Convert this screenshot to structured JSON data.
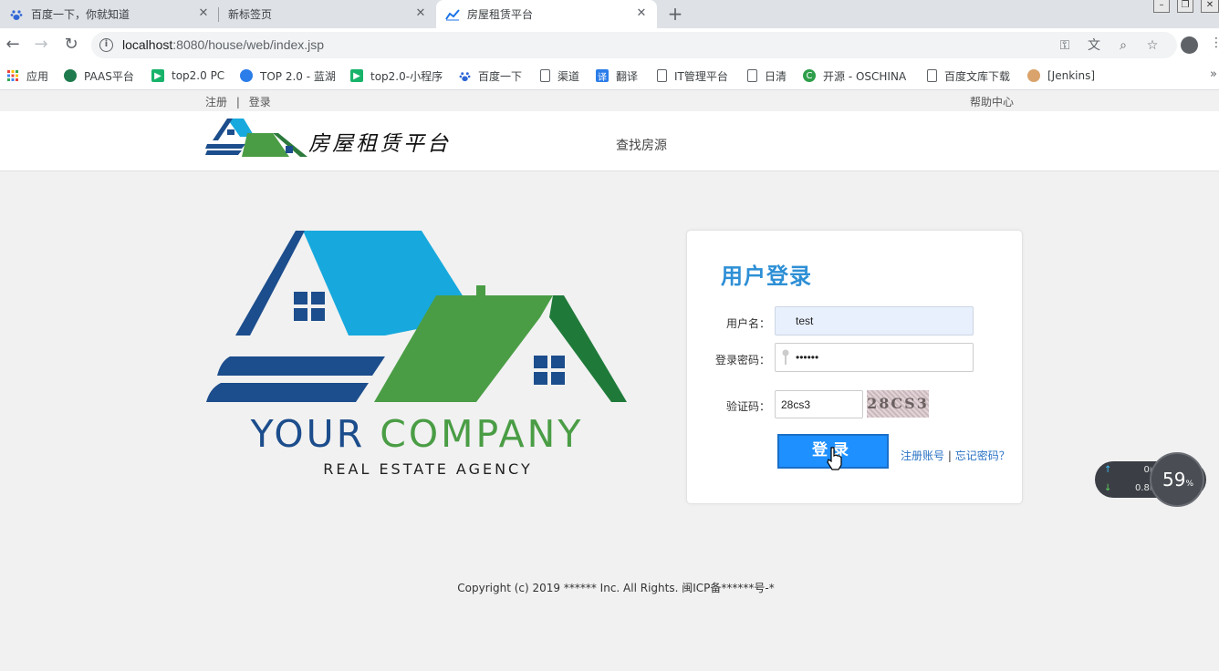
{
  "browser": {
    "tabs": [
      {
        "title": "百度一下，你就知道",
        "icon": "baidu-paw-icon"
      },
      {
        "title": "新标签页",
        "icon": ""
      },
      {
        "title": "房屋租赁平台",
        "icon": "chart-icon"
      }
    ],
    "url_host": "localhost",
    "url_path": ":8080/house/web/index.jsp",
    "bookmarks": [
      "应用",
      "PAAS平台",
      "top2.0 PC",
      "TOP 2.0 - 蓝湖",
      "top2.0-小程序",
      "百度一下",
      "渠道",
      "翻译",
      "IT管理平台",
      "日清",
      "开源 - OSCHINA",
      "百度文库下载",
      "[Jenkins]"
    ],
    "bookmarks_more": "»"
  },
  "topbar": {
    "register": "注册",
    "separator": "|",
    "login": "登录",
    "help": "帮助中心"
  },
  "header": {
    "brand": "房屋租赁平台",
    "nav_find": "查找房源"
  },
  "hero": {
    "your": "YOUR",
    "company": "COMPANY",
    "agency": "REAL ESTATE AGENCY"
  },
  "login": {
    "title": "用户登录",
    "username_label": "用户名：",
    "username_value": "test",
    "password_label": "登录密码：",
    "password_value": "••••••",
    "captcha_label": "验证码：",
    "captcha_value": "28cs3",
    "captcha_image_text": "28CS3",
    "submit": "登录",
    "register_link": "注册账号",
    "link_sep": "|",
    "forgot_link": "忘记密码？"
  },
  "footer": {
    "copyright": "Copyright (c) 2019 ****** Inc. All Rights. 闽ICP备******号-*"
  },
  "speed_widget": {
    "up": "0",
    "down": "0.8",
    "unit": "K/s",
    "percent": "59",
    "percent_sign": "%"
  },
  "colors": {
    "primary": "#1e90ff",
    "title_blue": "#2d8fd5",
    "logo_blue": "#1c4d8c",
    "logo_green": "#4a9d45",
    "logo_sky": "#17a9dd"
  }
}
